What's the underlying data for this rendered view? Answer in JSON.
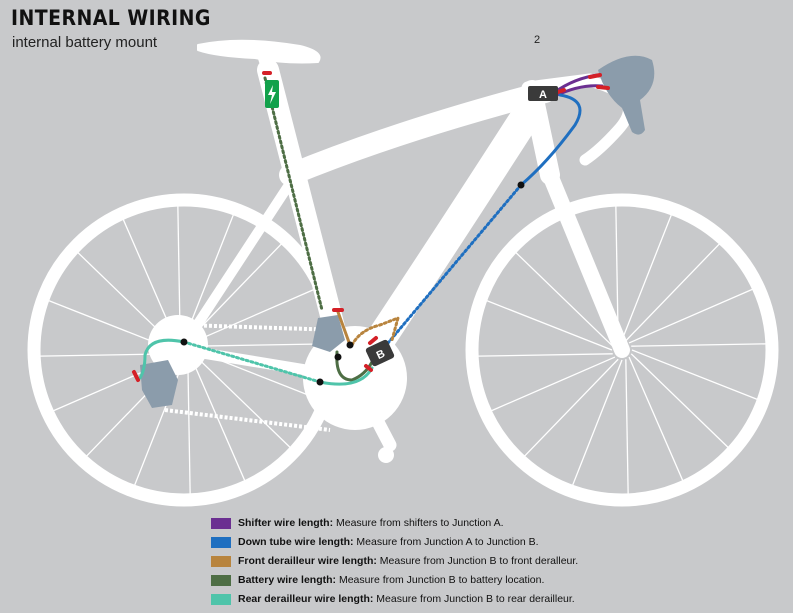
{
  "header": {
    "title": "INTERNAL WIRING",
    "subtitle": "internal battery mount",
    "page_number": "2"
  },
  "junctions": {
    "a_label": "A",
    "b_label": "B"
  },
  "colors": {
    "background": "#c8c9cb",
    "frame": "#ffffff",
    "components": "#8b9cab",
    "connector_red": "#d42027",
    "junction_body": "#3a3a3a",
    "battery_green": "#12a14b"
  },
  "legend": [
    {
      "label": "Shifter wire length:",
      "text": " Measure from shifters to Junction A.",
      "color": "#6b2f91"
    },
    {
      "label": "Down tube wire length:",
      "text": " Measure from Junction A to Junction B.",
      "color": "#1f6fc0"
    },
    {
      "label": "Front derailleur wire length:",
      "text": " Measure from Junction B to front deralleur.",
      "color": "#b8843e"
    },
    {
      "label": "Battery wire length:",
      "text": " Measure from Junction B to battery location.",
      "color": "#4e6e45"
    },
    {
      "label": "Rear derailleur wire length:",
      "text": " Measure from Junction B to rear derailleur.",
      "color": "#4fc4aa"
    }
  ]
}
